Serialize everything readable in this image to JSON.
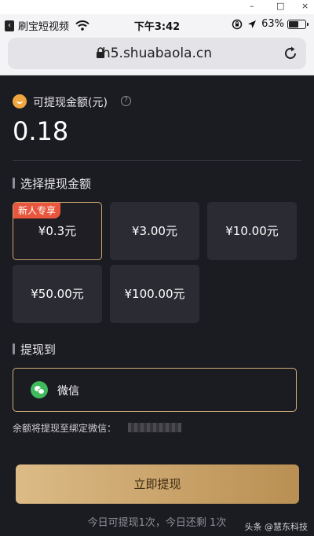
{
  "window": {
    "minimize": "–",
    "maximize": "□",
    "close": "×"
  },
  "status_bar": {
    "back_app": "刷宝短视频",
    "time": "下午3:42",
    "battery": "63%",
    "battery_level": 0.63
  },
  "address_bar": {
    "url": "h5.shuabaola.cn"
  },
  "balance": {
    "label": "可提现金额(元)",
    "help": "?",
    "value": "0.18"
  },
  "amount_section": {
    "title": "选择提现金额",
    "badge": "新人专享",
    "options": [
      "¥0.3元",
      "¥3.00元",
      "¥10.00元",
      "¥50.00元",
      "¥100.00元"
    ],
    "selected_index": 0
  },
  "destination_section": {
    "title": "提现到",
    "method": "微信",
    "hint": "余额将提现至绑定微信："
  },
  "submit_button": "立即提现",
  "footer": "今日可提现1次，今日还剩 1次",
  "watermark": "头条 @慧东科技",
  "colors": {
    "accent_gold": "#d2b078",
    "badge_red": "#e8573d",
    "wechat_green": "#3fba5c",
    "background": "#1b1b22"
  }
}
